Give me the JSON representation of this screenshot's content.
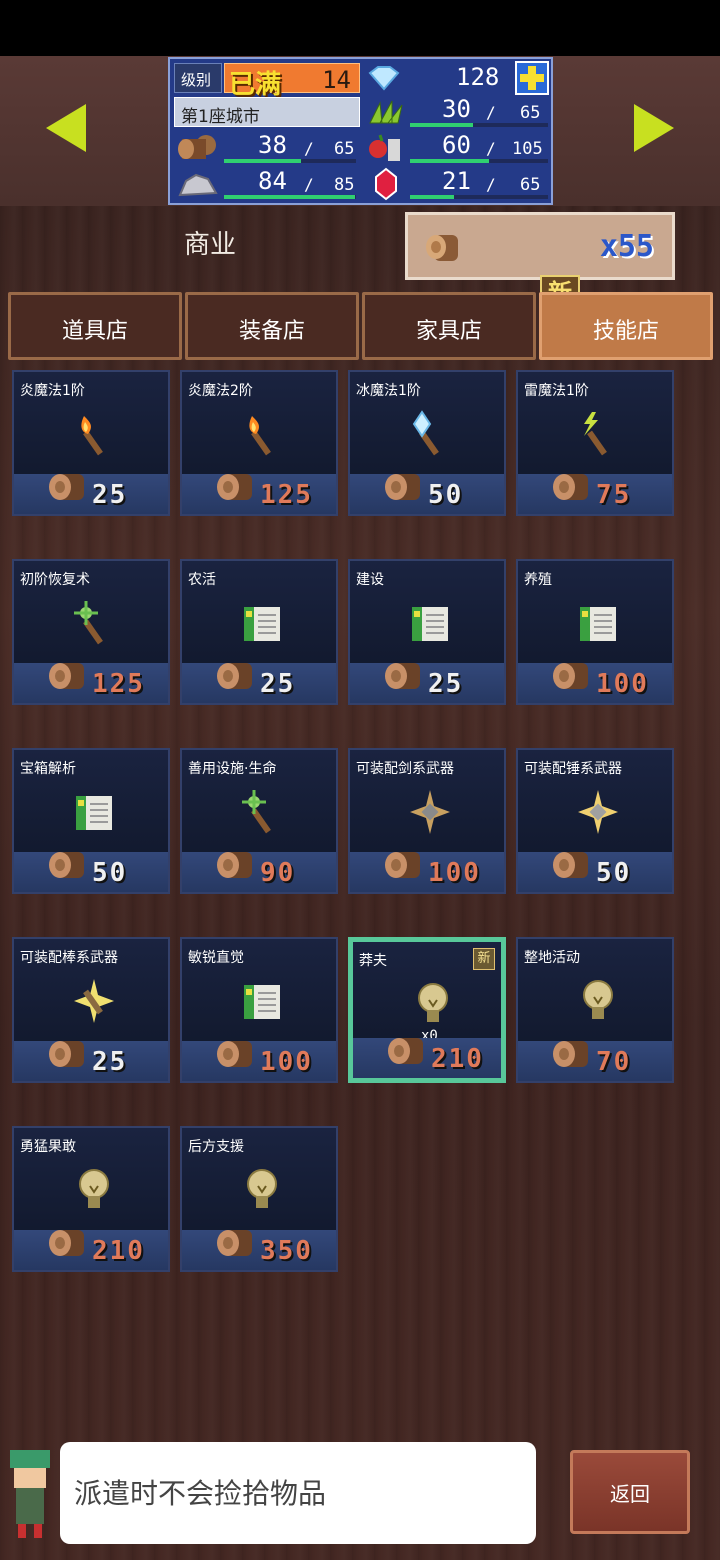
{
  "header": {
    "level_label": "级别",
    "level_status": "已满",
    "level_value": "14",
    "gems": "128",
    "city": "第1座城市",
    "grass_cur": "30",
    "grass_max": "65",
    "grass_fill": 0.46,
    "wood_cur": "38",
    "wood_max": "65",
    "wood_fill": 0.58,
    "food_cur": "60",
    "food_max": "105",
    "food_fill": 0.57,
    "ore_cur": "84",
    "ore_max": "85",
    "ore_fill": 0.99,
    "ruby_cur": "21",
    "ruby_max": "65",
    "ruby_fill": 0.32,
    "plus_icon": "plus-icon"
  },
  "section": {
    "title": "商业",
    "wood_count": "x55",
    "new_label": "新"
  },
  "tabs": [
    {
      "label": "道具店",
      "active": false
    },
    {
      "label": "装备店",
      "active": false
    },
    {
      "label": "家具店",
      "active": false
    },
    {
      "label": "技能店",
      "active": true
    }
  ],
  "items": [
    {
      "name": "炎魔法1阶",
      "price": "25",
      "icon": "fire-staff-icon",
      "price_color": "#f0f0f0"
    },
    {
      "name": "炎魔法2阶",
      "price": "125",
      "icon": "fire-staff-icon",
      "price_color": "#e07a5a"
    },
    {
      "name": "冰魔法1阶",
      "price": "50",
      "icon": "ice-staff-icon",
      "price_color": "#f0f0f0"
    },
    {
      "name": "雷魔法1阶",
      "price": "75",
      "icon": "thunder-staff-icon",
      "price_color": "#e07a5a"
    },
    {
      "name": "初阶恢复术",
      "price": "125",
      "icon": "heal-staff-icon",
      "price_color": "#e07a5a"
    },
    {
      "name": "农活",
      "price": "25",
      "icon": "scroll-icon",
      "price_color": "#f0f0f0"
    },
    {
      "name": "建设",
      "price": "25",
      "icon": "scroll-icon",
      "price_color": "#f0f0f0"
    },
    {
      "name": "养殖",
      "price": "100",
      "icon": "scroll-icon",
      "price_color": "#e07a5a"
    },
    {
      "name": "宝箱解析",
      "price": "50",
      "icon": "scroll-icon",
      "price_color": "#f0f0f0"
    },
    {
      "name": "善用设施·生命",
      "price": "90",
      "icon": "heal-staff-icon",
      "price_color": "#e07a5a"
    },
    {
      "name": "可装配剑系武器",
      "price": "100",
      "icon": "weapon-sword-icon",
      "price_color": "#e07a5a"
    },
    {
      "name": "可装配锤系武器",
      "price": "50",
      "icon": "weapon-hammer-icon",
      "price_color": "#f0f0f0"
    },
    {
      "name": "可装配棒系武器",
      "price": "25",
      "icon": "weapon-staff-icon",
      "price_color": "#f0f0f0"
    },
    {
      "name": "敏锐直觉",
      "price": "100",
      "icon": "scroll-icon",
      "price_color": "#e07a5a"
    },
    {
      "name": "莽夫",
      "price": "210",
      "icon": "lightbulb-icon",
      "price_color": "#e07a5a",
      "selected": true,
      "new": true,
      "qty": "x0"
    },
    {
      "name": "整地活动",
      "price": "70",
      "icon": "lightbulb-icon",
      "price_color": "#e07a5a"
    },
    {
      "name": "勇猛果敢",
      "price": "210",
      "icon": "lightbulb-icon",
      "price_color": "#e07a5a"
    },
    {
      "name": "后方支援",
      "price": "350",
      "icon": "lightbulb-icon",
      "price_color": "#e07a5a"
    }
  ],
  "footer": {
    "message": "派遣时不会捡拾物品",
    "back_label": "返回"
  }
}
